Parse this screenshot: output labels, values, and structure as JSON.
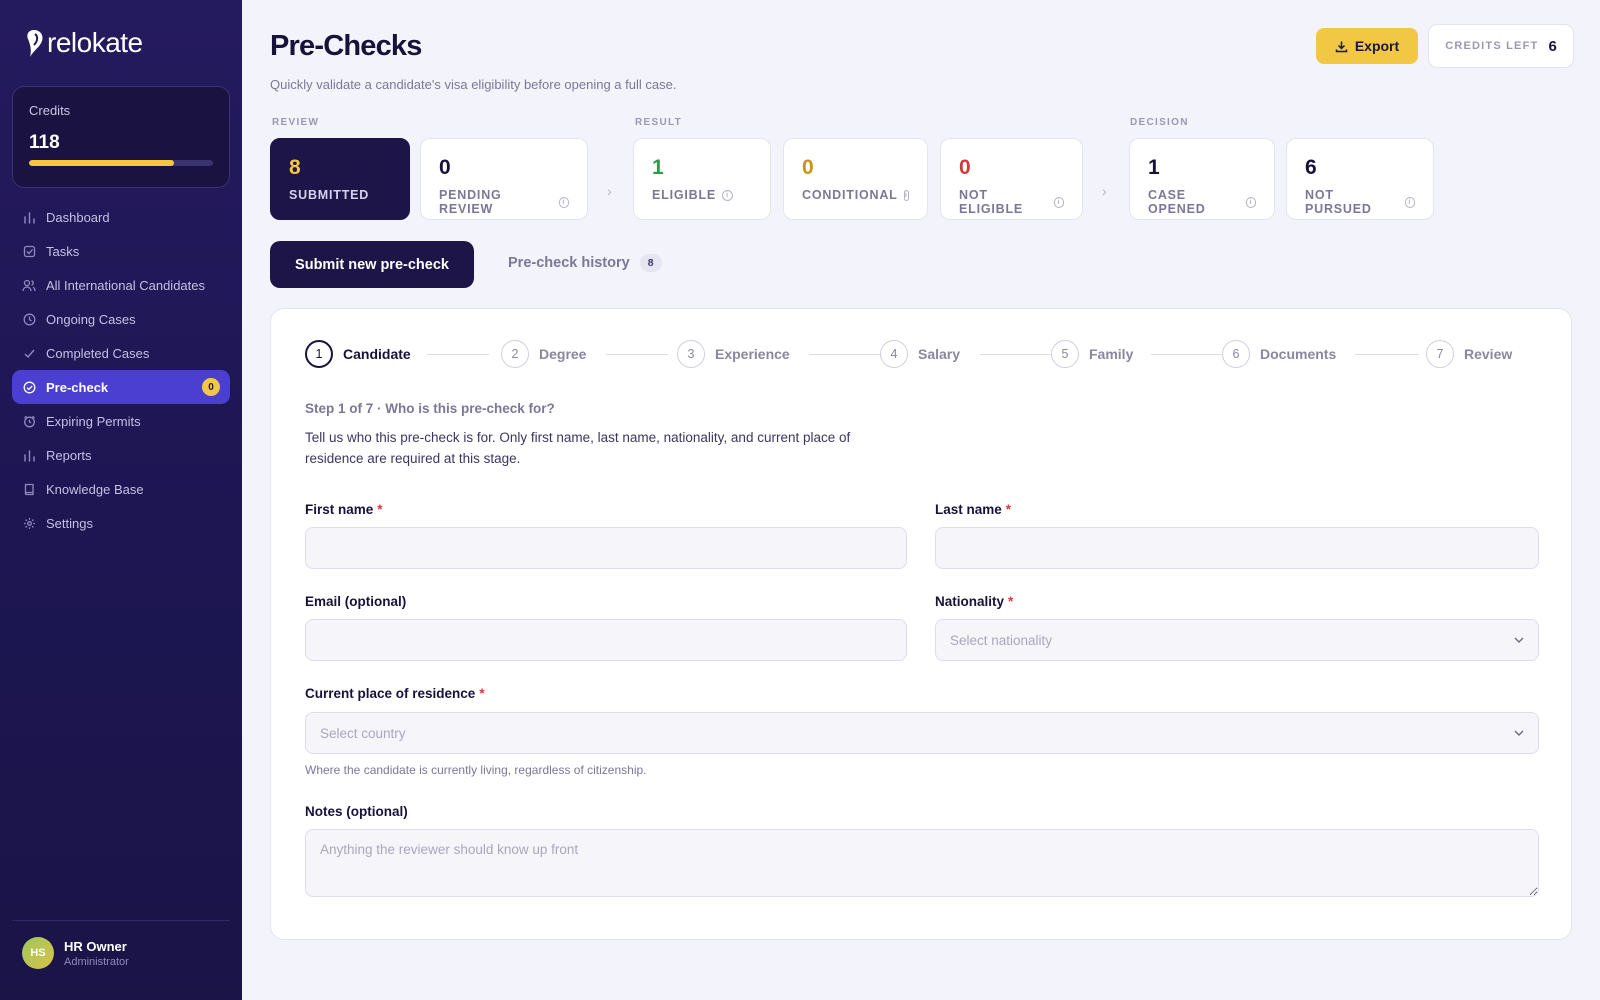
{
  "sidebar": {
    "logo": "relokate",
    "credits": {
      "label": "Credits",
      "value": "118",
      "progress": 0.79
    },
    "items": [
      {
        "label": "Dashboard",
        "icon": "bar-chart-icon"
      },
      {
        "label": "Tasks",
        "icon": "checkbox-icon"
      },
      {
        "label": "All International Candidates",
        "icon": "users-icon"
      },
      {
        "label": "Ongoing Cases",
        "icon": "clock-icon"
      },
      {
        "label": "Completed Cases",
        "icon": "check-icon"
      },
      {
        "label": "Pre-check",
        "icon": "check-circle-icon",
        "badge": "0",
        "active": true
      },
      {
        "label": "Expiring Permits",
        "icon": "alarm-icon"
      },
      {
        "label": "Reports",
        "icon": "bar-chart-icon"
      },
      {
        "label": "Knowledge Base",
        "icon": "book-icon"
      },
      {
        "label": "Settings",
        "icon": "gear-icon"
      }
    ],
    "user": {
      "initials": "HS",
      "name": "HR Owner",
      "role": "Administrator"
    }
  },
  "header": {
    "title": "Pre-Checks",
    "subtitle": "Quickly validate a candidate's visa eligibility before opening a full case.",
    "export_label": "Export",
    "credits_left_label": "CREDITS LEFT",
    "credits_left_value": "6"
  },
  "stats": {
    "groups": {
      "review": "REVIEW",
      "result": "RESULT",
      "decision": "DECISION"
    },
    "items": [
      {
        "value": "8",
        "label": "SUBMITTED",
        "color": "#f2c744"
      },
      {
        "value": "0",
        "label": "PENDING REVIEW",
        "color": "#171239"
      },
      {
        "value": "1",
        "label": "ELIGIBLE",
        "color": "#2a9d4b"
      },
      {
        "value": "0",
        "label": "CONDITIONAL",
        "color": "#c8951a"
      },
      {
        "value": "0",
        "label": "NOT ELIGIBLE",
        "color": "#d23a3a"
      },
      {
        "value": "1",
        "label": "CASE OPENED",
        "color": "#171239"
      },
      {
        "value": "6",
        "label": "NOT PURSUED",
        "color": "#171239"
      }
    ]
  },
  "tabs": {
    "primary": "Submit new pre-check",
    "history": "Pre-check history",
    "history_count": "8"
  },
  "stepper": [
    {
      "num": "1",
      "label": "Candidate"
    },
    {
      "num": "2",
      "label": "Degree"
    },
    {
      "num": "3",
      "label": "Experience"
    },
    {
      "num": "4",
      "label": "Salary"
    },
    {
      "num": "5",
      "label": "Family"
    },
    {
      "num": "6",
      "label": "Documents"
    },
    {
      "num": "7",
      "label": "Review"
    }
  ],
  "form": {
    "heading": "Step 1 of 7 · Who is this pre-check for?",
    "description": "Tell us who this pre-check is for. Only first name, last name, nationality, and current place of residence are required at this stage.",
    "first_name": {
      "label": "First name",
      "value": "",
      "placeholder": ""
    },
    "last_name": {
      "label": "Last name",
      "value": "",
      "placeholder": ""
    },
    "email": {
      "label": "Email (optional)",
      "value": "",
      "placeholder": ""
    },
    "nationality": {
      "label": "Nationality",
      "placeholder": "Select nationality"
    },
    "residence": {
      "label": "Current place of residence",
      "placeholder": "Select country",
      "help": "Where the candidate is currently living, regardless of citizenship."
    },
    "notes": {
      "label": "Notes (optional)",
      "placeholder": "Anything the reviewer should know up front"
    },
    "required_mark": "*"
  },
  "colors": {
    "accent": "#4a3fd0",
    "brand_dark": "#1d1548",
    "highlight": "#f2c744"
  }
}
